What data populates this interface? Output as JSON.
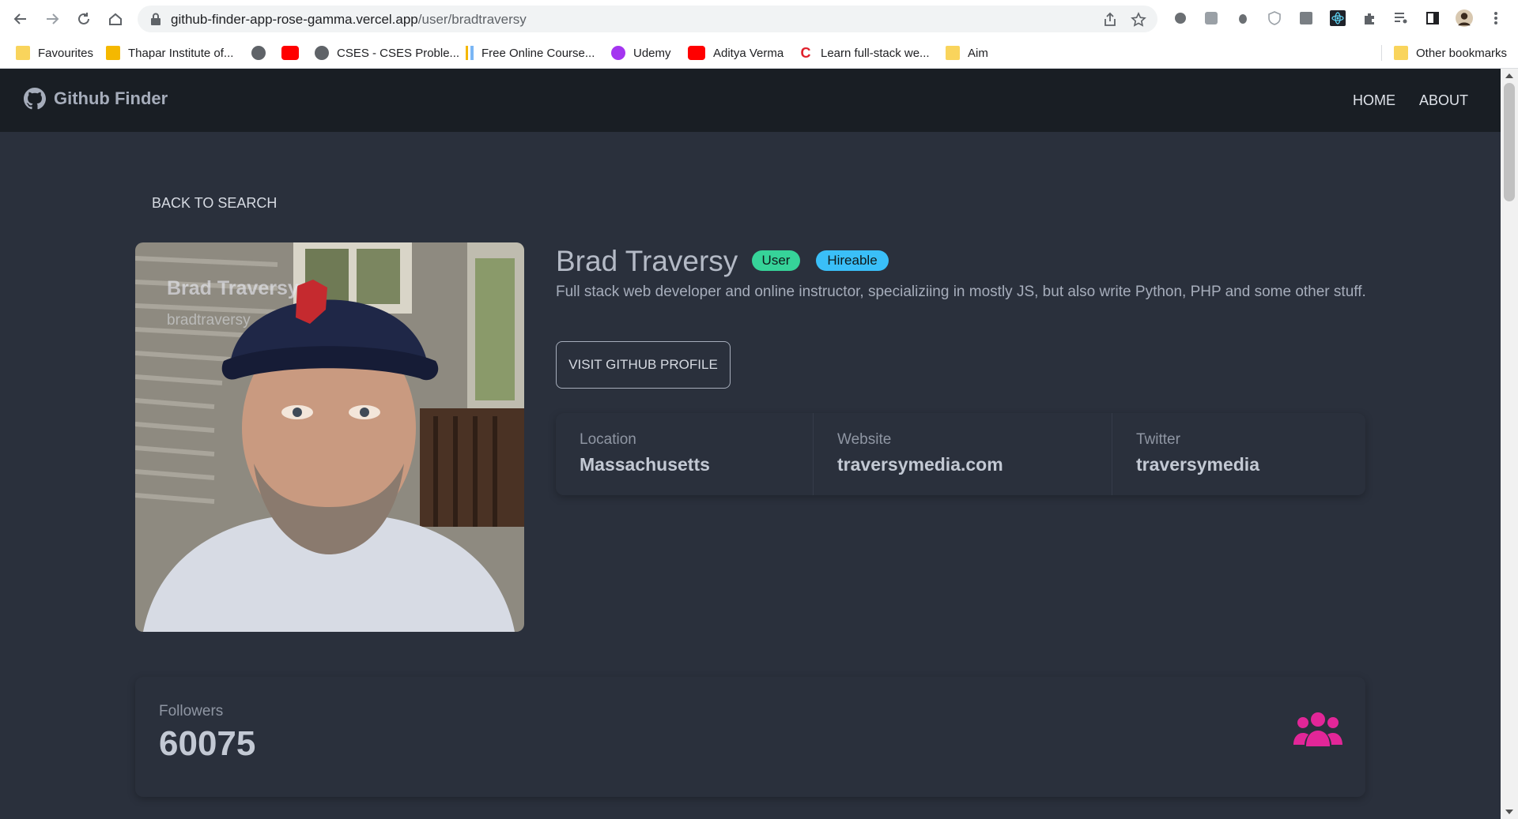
{
  "browser": {
    "url_host": "github-finder-app-rose-gamma.vercel.app",
    "url_path": "/user/bradtraversy",
    "bookmarks": [
      {
        "label": "Favourites",
        "icon": "folder-icon"
      },
      {
        "label": "Thapar Institute of...",
        "icon": "thapar-icon"
      },
      {
        "label": "",
        "icon": "globe-icon"
      },
      {
        "label": "",
        "icon": "youtube-icon"
      },
      {
        "label": "CSES - CSES Proble...",
        "icon": "globe-icon"
      },
      {
        "label": "Free Online Course...",
        "icon": "course-icon"
      },
      {
        "label": "Udemy",
        "icon": "udemy-icon"
      },
      {
        "label": "Aditya Verma",
        "icon": "youtube-icon"
      },
      {
        "label": "Learn full-stack we...",
        "icon": "codecademy-icon"
      },
      {
        "label": "Aim",
        "icon": "folder-icon"
      }
    ],
    "other_bookmarks": "Other bookmarks"
  },
  "navbar": {
    "brand": "Github Finder",
    "links": [
      "HOME",
      "ABOUT"
    ]
  },
  "profile": {
    "back_label": "BACK TO SEARCH",
    "name": "Brad Traversy",
    "login": "bradtraversy",
    "type_badge": "User",
    "hireable_badge": "Hireable",
    "bio": "Full stack web developer and online instructor, specializiing in mostly JS, but also write Python, PHP and some other stuff.",
    "visit_label": "VISIT GITHUB PROFILE",
    "stats": [
      {
        "title": "Location",
        "value": "Massachusetts"
      },
      {
        "title": "Website",
        "value": "traversymedia.com"
      },
      {
        "title": "Twitter",
        "value": "traversymedia"
      }
    ],
    "followers": {
      "title": "Followers",
      "value": "60075"
    }
  },
  "colors": {
    "page_bg": "#2a303c",
    "navbar_bg": "#191e24",
    "badge_user": "#36d399",
    "badge_hireable": "#3abff8",
    "followers_icon": "#e22698"
  }
}
